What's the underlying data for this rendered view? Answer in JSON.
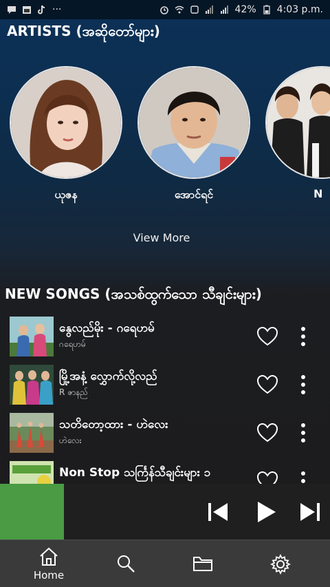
{
  "status_bar": {
    "battery": "42%",
    "time": "4:03 p.m.",
    "dots": "···"
  },
  "artists": {
    "title": "ARTISTS (အဆိုတော်များ)",
    "items": [
      {
        "name": "ယုဇန"
      },
      {
        "name": "အောင်ရင်"
      },
      {
        "name": "N"
      }
    ],
    "view_more": "View More"
  },
  "songs": {
    "title": "NEW SONGS (အသစ်ထွက်သော သီချင်းများ)",
    "items": [
      {
        "title": "နွေလည်မိုး - ဂရေဟမ်",
        "artist": "ဂရေဟမ်"
      },
      {
        "title": "မြို့အနံ့ လွှောက်လို့လည်",
        "artist": "R ဇာနည်"
      },
      {
        "title": "သတိတော့ထား - ဟဲလေး",
        "artist": "ဟဲလေး"
      },
      {
        "title": "Non Stop သင်္ကြန်သီချင်းများ ၁",
        "artist": ""
      }
    ]
  },
  "player": {
    "art_color": "#4a9b43"
  },
  "nav": {
    "home_label": "Home"
  },
  "colors": {
    "accent_green": "#4a9b43",
    "nav_bg": "#3a3a3a"
  }
}
